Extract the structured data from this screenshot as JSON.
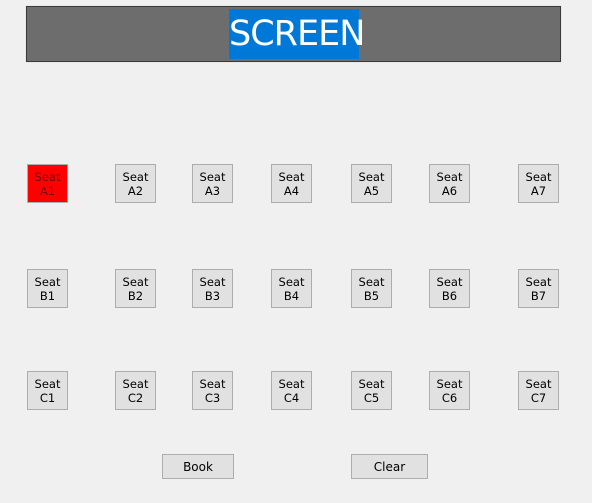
{
  "screen": {
    "label": "SCREEN"
  },
  "rows": [
    {
      "row": "A",
      "seats": [
        {
          "line1": "Seat",
          "line2": "A1",
          "state": "booked"
        },
        {
          "line1": "Seat",
          "line2": "A2",
          "state": "available"
        },
        {
          "line1": "Seat",
          "line2": "A3",
          "state": "available"
        },
        {
          "line1": "Seat",
          "line2": "A4",
          "state": "available"
        },
        {
          "line1": "Seat",
          "line2": "A5",
          "state": "available"
        },
        {
          "line1": "Seat",
          "line2": "A6",
          "state": "available"
        },
        {
          "line1": "Seat",
          "line2": "A7",
          "state": "available"
        }
      ]
    },
    {
      "row": "B",
      "seats": [
        {
          "line1": "Seat",
          "line2": "B1",
          "state": "available"
        },
        {
          "line1": "Seat",
          "line2": "B2",
          "state": "available"
        },
        {
          "line1": "Seat",
          "line2": "B3",
          "state": "available"
        },
        {
          "line1": "Seat",
          "line2": "B4",
          "state": "available"
        },
        {
          "line1": "Seat",
          "line2": "B5",
          "state": "available"
        },
        {
          "line1": "Seat",
          "line2": "B6",
          "state": "available"
        },
        {
          "line1": "Seat",
          "line2": "B7",
          "state": "available"
        }
      ]
    },
    {
      "row": "C",
      "seats": [
        {
          "line1": "Seat",
          "line2": "C1",
          "state": "available"
        },
        {
          "line1": "Seat",
          "line2": "C2",
          "state": "available"
        },
        {
          "line1": "Seat",
          "line2": "C3",
          "state": "available"
        },
        {
          "line1": "Seat",
          "line2": "C4",
          "state": "available"
        },
        {
          "line1": "Seat",
          "line2": "C5",
          "state": "available"
        },
        {
          "line1": "Seat",
          "line2": "C6",
          "state": "available"
        },
        {
          "line1": "Seat",
          "line2": "C7",
          "state": "available"
        }
      ]
    }
  ],
  "actions": {
    "book_label": "Book",
    "clear_label": "Clear"
  },
  "colors": {
    "booked": "#ff0000",
    "selection": "#0078d7",
    "screen_bg": "#6d6d6d"
  }
}
